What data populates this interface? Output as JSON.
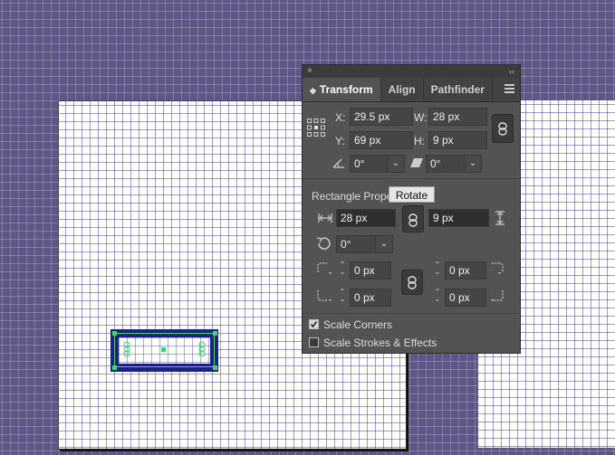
{
  "panel": {
    "tabs": [
      "Transform",
      "Align",
      "Pathfinder"
    ],
    "close_glyph": "×",
    "collapse_glyph": "‹‹",
    "x_label": "X:",
    "x_value": "29.5 px",
    "y_label": "Y:",
    "y_value": "69 px",
    "w_label": "W:",
    "w_value": "28 px",
    "h_label": "H:",
    "h_value": "9 px",
    "rotate_value": "0°",
    "shear_value": "0°",
    "rect_props_label": "Rectangle Propert",
    "tooltip": "Rotate",
    "rect_width": "28 px",
    "rect_height": "9 px",
    "rect_angle": "0°",
    "corner_tl": "0 px",
    "corner_tr": "0 px",
    "corner_bl": "0 px",
    "corner_br": "0 px",
    "scale_corners_label": "Scale Corners",
    "scale_corners_checked": true,
    "scale_strokes_label": "Scale Strokes & Effects",
    "scale_strokes_checked": false
  },
  "colors": {
    "canvas_bg": "#5c5787",
    "shape_fill": "#1b237e",
    "selection": "#4ad17a",
    "panel_bg": "#535353"
  }
}
